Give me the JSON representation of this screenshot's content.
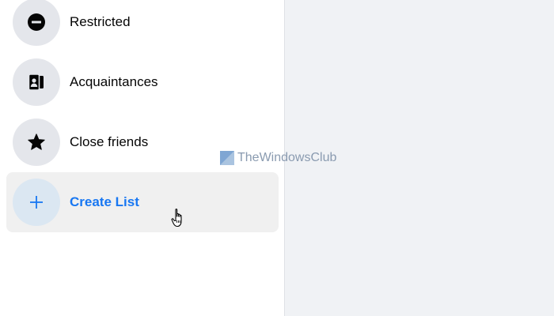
{
  "sidebar": {
    "items": [
      {
        "label": "Restricted",
        "icon": "restricted-icon"
      },
      {
        "label": "Acquaintances",
        "icon": "acquaintances-icon"
      },
      {
        "label": "Close friends",
        "icon": "star-icon"
      },
      {
        "label": "Create List",
        "icon": "plus-icon",
        "state": "hover"
      }
    ]
  },
  "watermark": {
    "text": "TheWindowsClub"
  },
  "colors": {
    "accent": "#1877f2",
    "icon_bg": "#e4e6eb",
    "accent_icon_bg": "#dbe7f2",
    "hover_bg": "#f0f0f0",
    "page_bg": "#f0f2f5"
  }
}
